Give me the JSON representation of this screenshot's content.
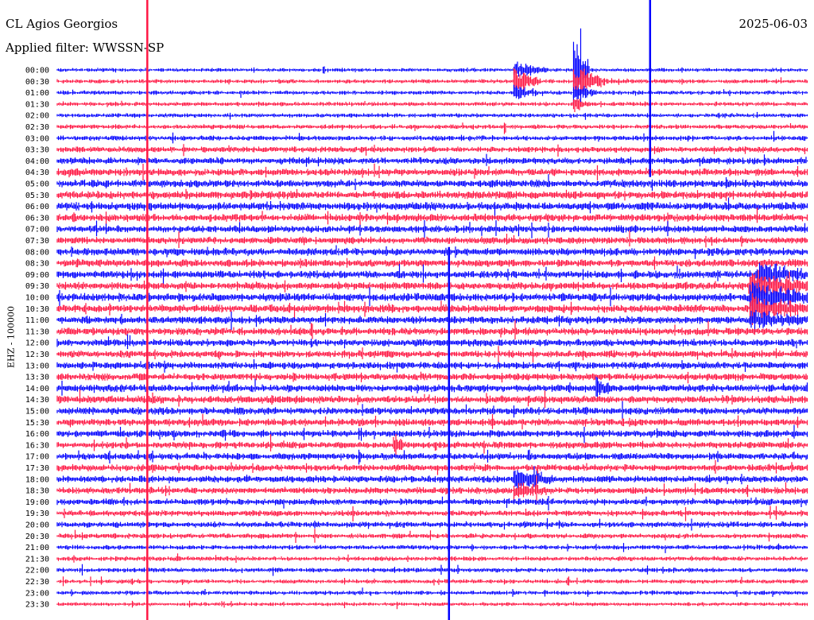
{
  "header": {
    "station": "CL Agios Georgios",
    "filter": "Applied filter: WWSSN-SP",
    "date": "2025-06-03"
  },
  "colors": {
    "trace_a": "#0000ff",
    "trace_b": "#ff1744",
    "background": "#ffffff"
  },
  "chart_data": {
    "type": "line",
    "title": "CL Agios Georgios",
    "subtitle": "Applied filter: WWSSN-SP",
    "ylabel": "EHZ - 100000",
    "xlabel": "",
    "grid": false,
    "legend": "none",
    "row_labels": [
      "00:00",
      "00:30",
      "01:00",
      "01:30",
      "02:00",
      "02:30",
      "03:00",
      "03:30",
      "04:00",
      "04:30",
      "05:00",
      "05:30",
      "06:00",
      "06:30",
      "07:00",
      "07:30",
      "08:00",
      "08:30",
      "09:00",
      "09:30",
      "10:00",
      "10:30",
      "11:00",
      "11:30",
      "12:00",
      "12:30",
      "13:00",
      "13:30",
      "14:00",
      "14:30",
      "15:00",
      "15:30",
      "16:00",
      "16:30",
      "17:00",
      "17:30",
      "18:00",
      "18:30",
      "19:00",
      "19:30",
      "20:00",
      "20:30",
      "21:00",
      "21:30",
      "22:00",
      "22:30",
      "23:00",
      "23:30"
    ],
    "series_colors": [
      "#0000ff",
      "#ff1744"
    ],
    "row_amplitude": [
      0.45,
      0.5,
      0.5,
      0.5,
      0.5,
      0.55,
      0.6,
      0.7,
      0.8,
      0.85,
      0.9,
      0.95,
      0.95,
      0.9,
      0.85,
      0.85,
      0.9,
      0.9,
      0.9,
      0.9,
      0.95,
      0.95,
      0.9,
      0.9,
      0.85,
      0.85,
      0.85,
      0.85,
      0.9,
      0.9,
      0.85,
      0.85,
      0.85,
      0.8,
      0.8,
      0.8,
      0.8,
      0.8,
      0.75,
      0.7,
      0.7,
      0.6,
      0.55,
      0.55,
      0.55,
      0.5,
      0.5,
      0.45
    ],
    "events": [
      {
        "row": 0,
        "x": 0.61,
        "width": 0.045,
        "amp": 4.0
      },
      {
        "row": 1,
        "x": 0.61,
        "width": 0.035,
        "amp": 6.5
      },
      {
        "row": 2,
        "x": 0.61,
        "width": 0.03,
        "amp": 3.0
      },
      {
        "row": 0,
        "x": 0.355,
        "width": 0.004,
        "amp": 2.0
      },
      {
        "row": 0,
        "x": 0.69,
        "width": 0.02,
        "amp": 20.0
      },
      {
        "row": 1,
        "x": 0.69,
        "width": 0.04,
        "amp": 8.0
      },
      {
        "row": 2,
        "x": 0.69,
        "width": 0.03,
        "amp": 4.0
      },
      {
        "row": 3,
        "x": 0.69,
        "width": 0.02,
        "amp": 2.5
      },
      {
        "row": 18,
        "x": 0.935,
        "width": 0.08,
        "amp": 3.0
      },
      {
        "row": 19,
        "x": 0.925,
        "width": 0.08,
        "amp": 4.0
      },
      {
        "row": 20,
        "x": 0.925,
        "width": 0.08,
        "amp": 4.0
      },
      {
        "row": 21,
        "x": 0.925,
        "width": 0.08,
        "amp": 3.0
      },
      {
        "row": 22,
        "x": 0.925,
        "width": 0.08,
        "amp": 2.0
      },
      {
        "row": 36,
        "x": 0.61,
        "width": 0.05,
        "amp": 3.0
      },
      {
        "row": 37,
        "x": 0.61,
        "width": 0.05,
        "amp": 2.0
      },
      {
        "row": 28,
        "x": 0.72,
        "width": 0.015,
        "amp": 2.5
      },
      {
        "row": 33,
        "x": 0.45,
        "width": 0.012,
        "amp": 2.5
      },
      {
        "row": 34,
        "x": 0.12,
        "width": 0.01,
        "amp": 2.0
      }
    ],
    "vertical_lines": [
      {
        "x": 0.12,
        "color": "#ff1744",
        "row_from": 0,
        "row_to": 47
      },
      {
        "x": 0.522,
        "color": "#0000ff",
        "row_from": 16,
        "row_to": 47
      },
      {
        "x": 0.79,
        "color": "#0000ff",
        "row_from": 0,
        "row_to": 9
      }
    ]
  }
}
